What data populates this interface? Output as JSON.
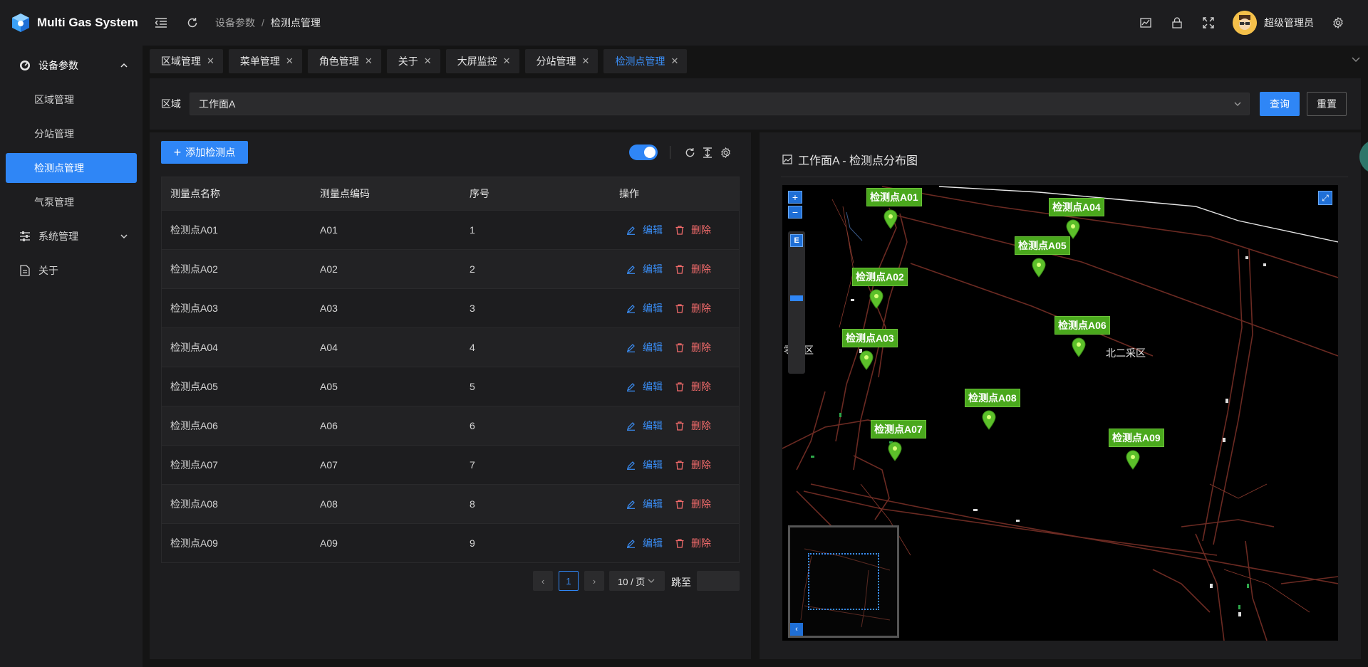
{
  "app": {
    "title": "Multi Gas System"
  },
  "header": {
    "breadcrumb": [
      "设备参数",
      "检测点管理"
    ],
    "breadcrumb_sep": "/",
    "username": "超级管理员"
  },
  "sidebar": {
    "group1": {
      "label": "设备参数",
      "icon": "gauge-icon",
      "expanded": true,
      "items": [
        {
          "label": "区域管理"
        },
        {
          "label": "分站管理"
        },
        {
          "label": "检测点管理",
          "active": true
        },
        {
          "label": "气泵管理"
        }
      ]
    },
    "group2": {
      "label": "系统管理",
      "icon": "sliders-icon",
      "expanded": false
    },
    "about": {
      "label": "关于",
      "icon": "document-icon"
    }
  },
  "tabs": [
    {
      "label": "区域管理"
    },
    {
      "label": "菜单管理"
    },
    {
      "label": "角色管理"
    },
    {
      "label": "关于"
    },
    {
      "label": "大屏监控"
    },
    {
      "label": "分站管理"
    },
    {
      "label": "检测点管理",
      "active": true
    }
  ],
  "filter": {
    "label": "区域",
    "value": "工作面A",
    "query_label": "查询",
    "reset_label": "重置"
  },
  "toolbar": {
    "add_label": "添加检测点",
    "switch_on": true
  },
  "table": {
    "columns": [
      "测量点名称",
      "测量点编码",
      "序号",
      "操作"
    ],
    "edit_label": "编辑",
    "delete_label": "删除",
    "rows": [
      {
        "name": "检测点A01",
        "code": "A01",
        "seq": "1"
      },
      {
        "name": "检测点A02",
        "code": "A02",
        "seq": "2"
      },
      {
        "name": "检测点A03",
        "code": "A03",
        "seq": "3"
      },
      {
        "name": "检测点A04",
        "code": "A04",
        "seq": "4"
      },
      {
        "name": "检测点A05",
        "code": "A05",
        "seq": "5"
      },
      {
        "name": "检测点A06",
        "code": "A06",
        "seq": "6"
      },
      {
        "name": "检测点A07",
        "code": "A07",
        "seq": "7"
      },
      {
        "name": "检测点A08",
        "code": "A08",
        "seq": "8"
      },
      {
        "name": "检测点A09",
        "code": "A09",
        "seq": "9"
      }
    ]
  },
  "pagination": {
    "current": "1",
    "page_size": "10 / 页",
    "jump_label": "跳至"
  },
  "map_panel": {
    "title": "工作面A - 检测点分布图",
    "zoom_in": "+",
    "zoom_out": "−",
    "layer_label": "E",
    "area_labels": [
      "零采区",
      "北二采区"
    ],
    "markers": [
      {
        "label": "检测点A01"
      },
      {
        "label": "检测点A04"
      },
      {
        "label": "检测点A05"
      },
      {
        "label": "检测点A02"
      },
      {
        "label": "检测点A06"
      },
      {
        "label": "检测点A03"
      },
      {
        "label": "检测点A08"
      },
      {
        "label": "检测点A07"
      },
      {
        "label": "检测点A09"
      }
    ]
  },
  "colors": {
    "accent": "#2f86f6",
    "danger": "#f56c6c",
    "marker": "#4aa81d",
    "background": "#141414",
    "panel": "#1d1d1f"
  }
}
